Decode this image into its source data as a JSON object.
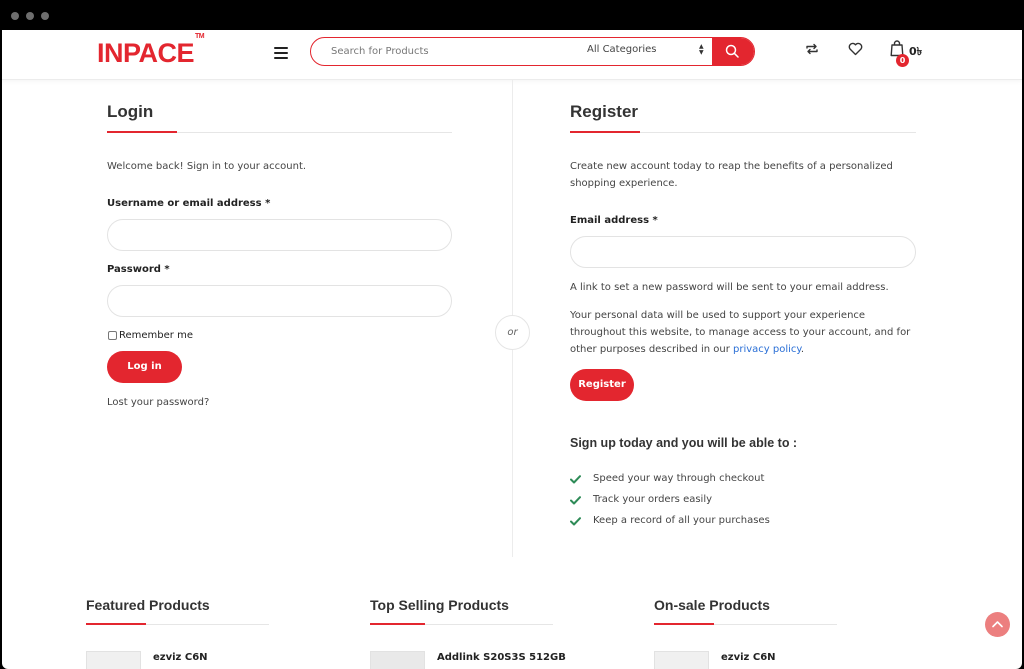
{
  "header": {
    "logo": "INPACE",
    "logo_tm": "TM",
    "search_placeholder": "Search for Products",
    "category": "All Categories",
    "cart_count": "0",
    "cart_amount": "0৳"
  },
  "login": {
    "title": "Login",
    "welcome": "Welcome back! Sign in to your account.",
    "username_label": "Username or email address *",
    "password_label": "Password *",
    "remember": "Remember me",
    "button": "Log in",
    "lost": "Lost your password?"
  },
  "separator": "or",
  "register": {
    "title": "Register",
    "intro": "Create new account today to reap the benefits of a personalized shopping experience.",
    "email_label": "Email address *",
    "link_note": "A link to set a new password will be sent to your email address.",
    "privacy_pre": "Your personal data will be used to support your experience throughout this website, to manage access to your account, and for other purposes described in our ",
    "privacy_link": "privacy policy",
    "privacy_post": ".",
    "button": "Register",
    "signup_title": "Sign up today and you will be able to :",
    "benefits": [
      "Speed your way through checkout",
      "Track your orders easily",
      "Keep a record of all your purchases"
    ]
  },
  "sections": {
    "featured": "Featured Products",
    "top_selling": "Top Selling Products",
    "on_sale": "On-sale Products"
  },
  "products": {
    "featured_first": "ezviz C6N",
    "top_first": "Addlink S20S3S 512GB",
    "sale_first": "ezviz C6N"
  },
  "colors": {
    "accent": "#e3262f",
    "link": "#2a6fd6",
    "check": "#2e8b57"
  }
}
